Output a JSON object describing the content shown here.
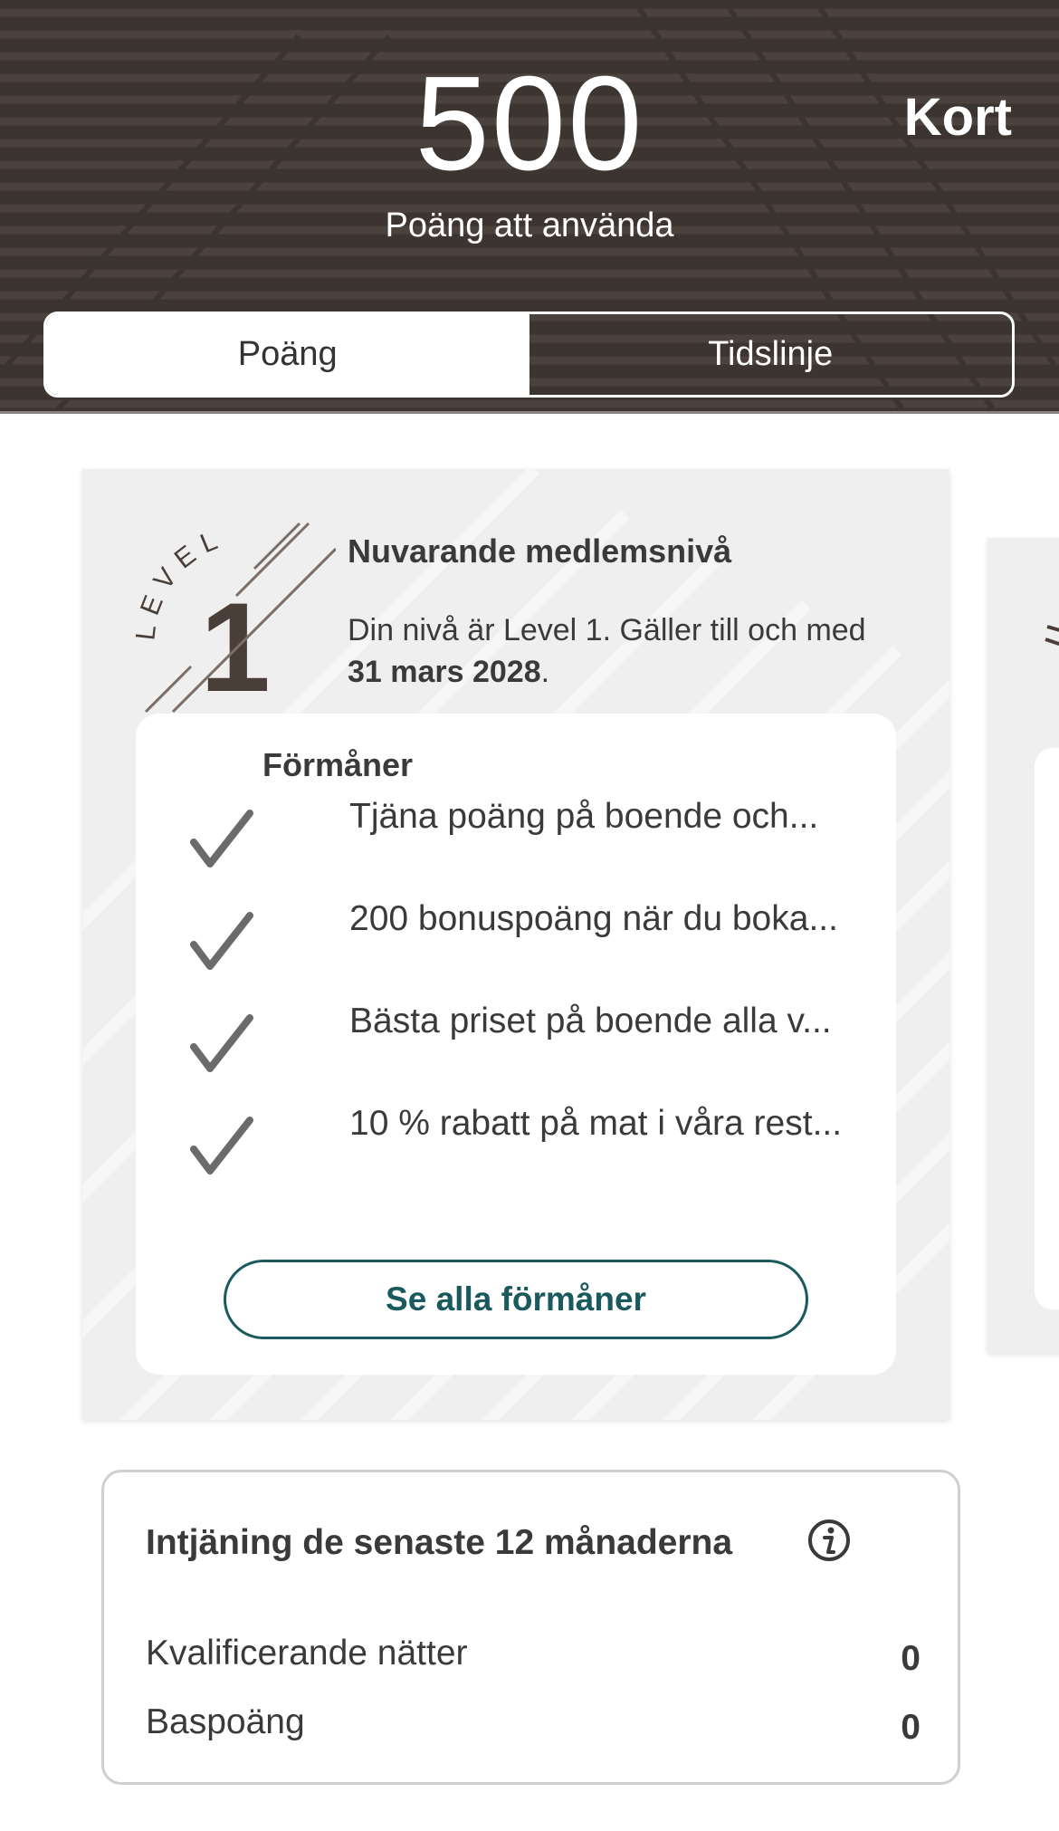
{
  "header": {
    "points_value": "500",
    "points_label": "Poäng att använda",
    "card_link": "Kort",
    "background_color": "#3c3430",
    "tabs": [
      {
        "label": "Poäng",
        "active": true
      },
      {
        "label": "Tidslinje",
        "active": false
      }
    ]
  },
  "level_card": {
    "badge_word": "LEVEL",
    "badge_number": "1",
    "title": "Nuvarande medlemsnivå",
    "description_prefix": "Din nivå är Level 1. Gäller till och med ",
    "valid_until": "31 mars 2028",
    "description_suffix": ".",
    "benefits_title": "Förmåner",
    "benefits": [
      "Tjäna poäng på boende och...",
      "200 bonuspoäng när du boka...",
      "Bästa priset på boende alla v...",
      "10 % rabatt på mat i våra rest..."
    ],
    "see_all_label": "Se alla förmåner",
    "accent_color": "#1a5a5f"
  },
  "earnings": {
    "title": "Intjäning de senaste 12 månaderna",
    "info_icon": "info-icon",
    "rows": [
      {
        "label": "Kvalificerande nätter",
        "value": "0"
      },
      {
        "label": "Baspoäng",
        "value": "0"
      }
    ]
  }
}
